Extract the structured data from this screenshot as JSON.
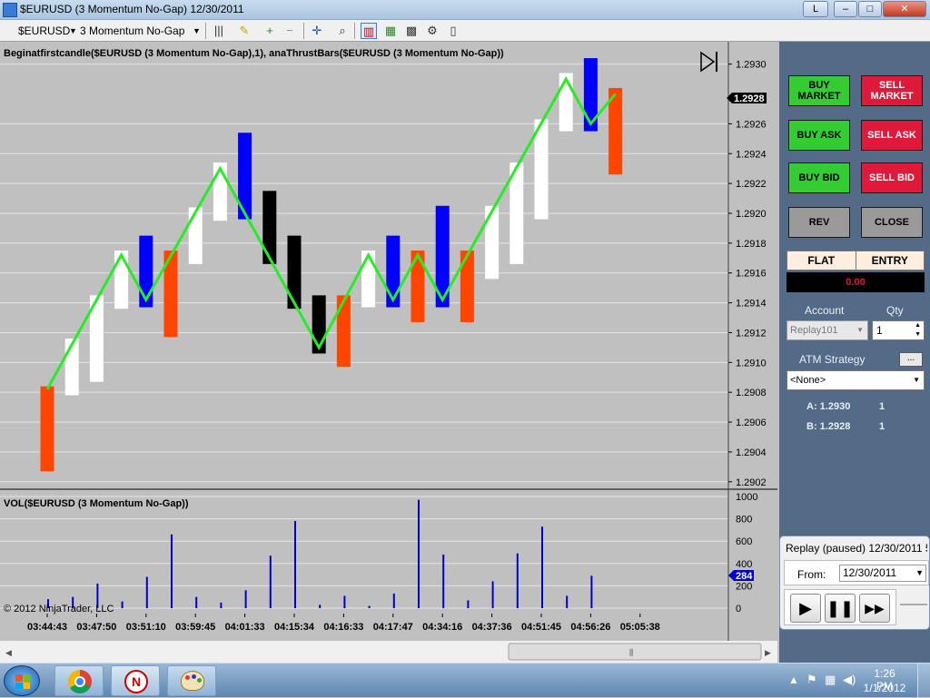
{
  "window": {
    "title": "$EURUSD (3 Momentum No-Gap)  12/30/2011",
    "btn_l": "L"
  },
  "toolbar": {
    "instrument": "$EURUSD",
    "period": "3 Momentum No-Gap"
  },
  "chart": {
    "indicator_label": "Beginatfirstcandle($EURUSD (3 Momentum No-Gap),1), anaThrustBars($EURUSD (3 Momentum No-Gap))",
    "volume_label": "VOL($EURUSD (3 Momentum No-Gap))",
    "copyright": "© 2012 NinjaTrader, LLC",
    "price_ticks": [
      "1.2930",
      "1.2926",
      "1.2924",
      "1.2922",
      "1.2920",
      "1.2918",
      "1.2916",
      "1.2914",
      "1.2912",
      "1.2910",
      "1.2908",
      "1.2906",
      "1.2904",
      "1.2902"
    ],
    "price_ticks_values": [
      1.293,
      1.2926,
      1.2924,
      1.2922,
      1.292,
      1.2918,
      1.2916,
      1.2914,
      1.2912,
      1.291,
      1.2908,
      1.2906,
      1.2904,
      1.2902
    ],
    "current_price": "1.2928",
    "volume_ticks": [
      "1000",
      "800",
      "600",
      "400",
      "200",
      "0"
    ],
    "current_volume": "284",
    "time_ticks": [
      "03:44:43",
      "03:47:50",
      "03:51:10",
      "03:59:45",
      "04:01:33",
      "04:15:34",
      "04:16:33",
      "04:17:47",
      "04:34:16",
      "04:37:36",
      "04:51:45",
      "04:56:26",
      "05:05:38"
    ],
    "colors": {
      "up": "#ffffff",
      "down": "#000000",
      "thrust_up": "#0000ff",
      "thrust_down": "#ff4500",
      "line": "#22ee22",
      "volume": "#0000cc"
    }
  },
  "chart_data": {
    "type": "candlestick",
    "price_range": [
      1.29015,
      1.29315
    ],
    "volume_range": [
      0,
      1000
    ],
    "bars": [
      {
        "o": 1.29084,
        "c": 1.29027,
        "color": "thrust_down",
        "vol": 80
      },
      {
        "o": 1.29078,
        "c": 1.29116,
        "color": "up",
        "vol": 100
      },
      {
        "o": 1.29087,
        "c": 1.29145,
        "color": "up",
        "vol": 220
      },
      {
        "o": 1.29136,
        "c": 1.29175,
        "color": "up",
        "vol": 60
      },
      {
        "o": 1.29137,
        "c": 1.29185,
        "color": "thrust_up",
        "vol": 280
      },
      {
        "o": 1.29175,
        "c": 1.29117,
        "color": "thrust_down",
        "vol": 660
      },
      {
        "o": 1.29166,
        "c": 1.29204,
        "color": "up",
        "vol": 100
      },
      {
        "o": 1.29195,
        "c": 1.29234,
        "color": "up",
        "vol": 50
      },
      {
        "o": 1.29196,
        "c": 1.29254,
        "color": "thrust_up",
        "vol": 160
      },
      {
        "o": 1.29215,
        "c": 1.29166,
        "color": "down",
        "vol": 470
      },
      {
        "o": 1.29185,
        "c": 1.29136,
        "color": "down",
        "vol": 780
      },
      {
        "o": 1.29145,
        "c": 1.29106,
        "color": "down",
        "vol": 30
      },
      {
        "o": 1.29145,
        "c": 1.29097,
        "color": "thrust_down",
        "vol": 110
      },
      {
        "o": 1.29137,
        "c": 1.29175,
        "color": "up",
        "vol": 20
      },
      {
        "o": 1.29137,
        "c": 1.29185,
        "color": "thrust_up",
        "vol": 130
      },
      {
        "o": 1.29175,
        "c": 1.29127,
        "color": "thrust_down",
        "vol": 970
      },
      {
        "o": 1.29137,
        "c": 1.29205,
        "color": "thrust_up",
        "vol": 480
      },
      {
        "o": 1.29175,
        "c": 1.29127,
        "color": "thrust_down",
        "vol": 70
      },
      {
        "o": 1.29156,
        "c": 1.29205,
        "color": "up",
        "vol": 240
      },
      {
        "o": 1.29166,
        "c": 1.29234,
        "color": "up",
        "vol": 490
      },
      {
        "o": 1.29196,
        "c": 1.29263,
        "color": "up",
        "vol": 730
      },
      {
        "o": 1.29255,
        "c": 1.29294,
        "color": "up",
        "vol": 110
      },
      {
        "o": 1.29255,
        "c": 1.29304,
        "color": "thrust_up",
        "vol": 290
      },
      {
        "o": 1.29284,
        "c": 1.29226,
        "color": "thrust_down",
        "vol": null
      }
    ],
    "line": [
      {
        "bar": 0,
        "v": 1.29082
      },
      {
        "bar": 3,
        "v": 1.29172
      },
      {
        "bar": 4,
        "v": 1.29142
      },
      {
        "bar": 7,
        "v": 1.2923
      },
      {
        "bar": 9,
        "v": 1.2917
      },
      {
        "bar": 11,
        "v": 1.2911
      },
      {
        "bar": 13,
        "v": 1.29172
      },
      {
        "bar": 14,
        "v": 1.29142
      },
      {
        "bar": 15,
        "v": 1.29172
      },
      {
        "bar": 16,
        "v": 1.29142
      },
      {
        "bar": 21,
        "v": 1.2929
      },
      {
        "bar": 22,
        "v": 1.2926
      },
      {
        "bar": 23,
        "v": 1.2928
      }
    ]
  },
  "panel": {
    "buy_market": "BUY MARKET",
    "sell_market": "SELL MARKET",
    "buy_ask": "BUY ASK",
    "sell_ask": "SELL ASK",
    "buy_bid": "BUY BID",
    "sell_bid": "SELL BID",
    "rev": "REV",
    "close": "CLOSE",
    "flat": "FLAT",
    "entry": "ENTRY",
    "pnl": "0.00",
    "account_label": "Account",
    "qty_label": "Qty",
    "account_value": "Replay101",
    "qty_value": "1",
    "atm_label": "ATM Strategy",
    "atm_btn": "...",
    "atm_value": "<None>",
    "ask_label": "A: 1.2930",
    "ask_qty": "1",
    "bid_label": "B: 1.2928",
    "bid_qty": "1"
  },
  "replay": {
    "title": "Replay (paused) 12/30/2011 5",
    "from_label": "From:",
    "from_value": "12/30/2011"
  },
  "taskbar": {
    "time": "1:26 PM",
    "date": "1/1/2012"
  }
}
